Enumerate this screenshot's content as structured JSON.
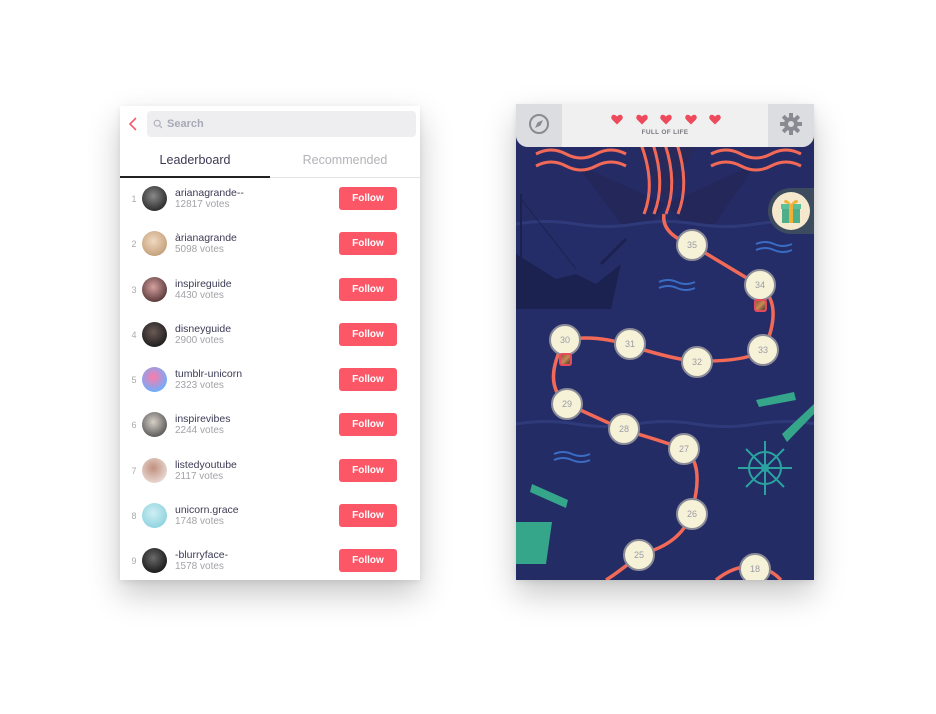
{
  "leaderboard_app": {
    "search": {
      "placeholder": "Search",
      "value": ""
    },
    "tabs": [
      {
        "label": "Leaderboard",
        "active": true
      },
      {
        "label": "Recommended",
        "active": false
      }
    ],
    "follow_label": "Follow",
    "accent_color": "#fb5767",
    "entries": [
      {
        "rank": "1",
        "name": "arianagrande--",
        "votes": "12817 votes"
      },
      {
        "rank": "2",
        "name": "àrianagrande",
        "votes": "5098 votes"
      },
      {
        "rank": "3",
        "name": "inspireguide",
        "votes": "4430 votes"
      },
      {
        "rank": "4",
        "name": "disneyguide",
        "votes": "2900 votes"
      },
      {
        "rank": "5",
        "name": "tumblr-unicorn",
        "votes": "2323 votes"
      },
      {
        "rank": "6",
        "name": "inspirevibes",
        "votes": "2244 votes"
      },
      {
        "rank": "7",
        "name": "listedyoutube",
        "votes": "2117 votes"
      },
      {
        "rank": "8",
        "name": "unicorn.grace",
        "votes": "1748 votes"
      },
      {
        "rank": "9",
        "name": "-blurryface-",
        "votes": "1578 votes"
      }
    ]
  },
  "game_map": {
    "hearts_count": 5,
    "heart_color": "#ee4a5c",
    "status_label": "FULL OF LIFE",
    "levels": [
      "35",
      "34",
      "33",
      "32",
      "31",
      "30",
      "29",
      "28",
      "27",
      "26",
      "25",
      "18"
    ],
    "path_color": "#f26a57",
    "background_color": "#252b64"
  }
}
